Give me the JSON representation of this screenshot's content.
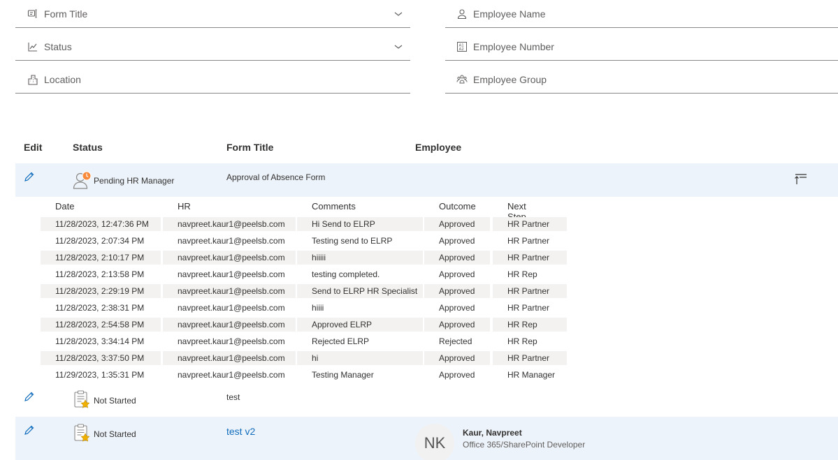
{
  "filters": {
    "form_title": "Form Title",
    "status": "Status",
    "location": "Location",
    "employee_name": "Employee Name",
    "employee_number": "Employee Number",
    "employee_group": "Employee Group"
  },
  "columns": {
    "edit": "Edit",
    "status": "Status",
    "form_title": "Form Title",
    "employee": "Employee"
  },
  "rows": [
    {
      "status": "Pending HR Manager",
      "title": "Approval of Absence Form"
    },
    {
      "status": "Not Started",
      "title": "test"
    },
    {
      "status": "Not Started",
      "title": "test v2",
      "employee_name": "Kaur, Navpreet",
      "employee_title": "Office 365/SharePoint Developer",
      "initials": "NK"
    }
  ],
  "history": {
    "headers": {
      "date": "Date",
      "hr": "HR",
      "comments": "Comments",
      "outcome": "Outcome",
      "next_step": "Next Step"
    },
    "entries": [
      {
        "date": "11/28/2023, 12:47:36 PM",
        "hr": "navpreet.kaur1@peelsb.com",
        "comments": "Hi Send to ELRP",
        "outcome": "Approved",
        "next_step": "HR Partner"
      },
      {
        "date": "11/28/2023, 2:07:34 PM",
        "hr": "navpreet.kaur1@peelsb.com",
        "comments": "Testing send to ELRP",
        "outcome": "Approved",
        "next_step": "HR Partner"
      },
      {
        "date": "11/28/2023, 2:10:17 PM",
        "hr": "navpreet.kaur1@peelsb.com",
        "comments": "hiiiii",
        "outcome": "Approved",
        "next_step": "HR Partner"
      },
      {
        "date": "11/28/2023, 2:13:58 PM",
        "hr": "navpreet.kaur1@peelsb.com",
        "comments": "testing completed.",
        "outcome": "Approved",
        "next_step": "HR Rep"
      },
      {
        "date": "11/28/2023, 2:29:19 PM",
        "hr": "navpreet.kaur1@peelsb.com",
        "comments": "Send to ELRP HR Specialist",
        "outcome": "Approved",
        "next_step": "HR Partner"
      },
      {
        "date": "11/28/2023, 2:38:31 PM",
        "hr": "navpreet.kaur1@peelsb.com",
        "comments": "hiiii",
        "outcome": "Approved",
        "next_step": "HR Partner"
      },
      {
        "date": "11/28/2023, 2:54:58 PM",
        "hr": "navpreet.kaur1@peelsb.com",
        "comments": "Approved ELRP",
        "outcome": "Approved",
        "next_step": "HR Rep"
      },
      {
        "date": "11/28/2023, 3:34:14 PM",
        "hr": "navpreet.kaur1@peelsb.com",
        "comments": "Rejected ELRP",
        "outcome": "Rejected",
        "next_step": "HR Rep"
      },
      {
        "date": "11/28/2023, 3:37:50 PM",
        "hr": "navpreet.kaur1@peelsb.com",
        "comments": "hi",
        "outcome": "Approved",
        "next_step": "HR Partner"
      },
      {
        "date": "11/29/2023, 1:35:31 PM",
        "hr": "navpreet.kaur1@peelsb.com",
        "comments": "Testing Manager",
        "outcome": "Approved",
        "next_step": "HR Manager"
      }
    ]
  },
  "icons": {
    "form": "form-icon",
    "status": "chart-icon",
    "location": "building-icon",
    "person": "person-icon",
    "number": "number-icon",
    "group": "people-icon",
    "edit": "pencil-icon",
    "collapse": "collapse-icon",
    "pending": "pending-person-icon",
    "not_started": "clipboard-star-icon"
  },
  "colors": {
    "accent": "#0f6cbd",
    "row_highlight": "#edf3fa",
    "pending_badge": "#f7893b",
    "star": "#f0b000"
  }
}
